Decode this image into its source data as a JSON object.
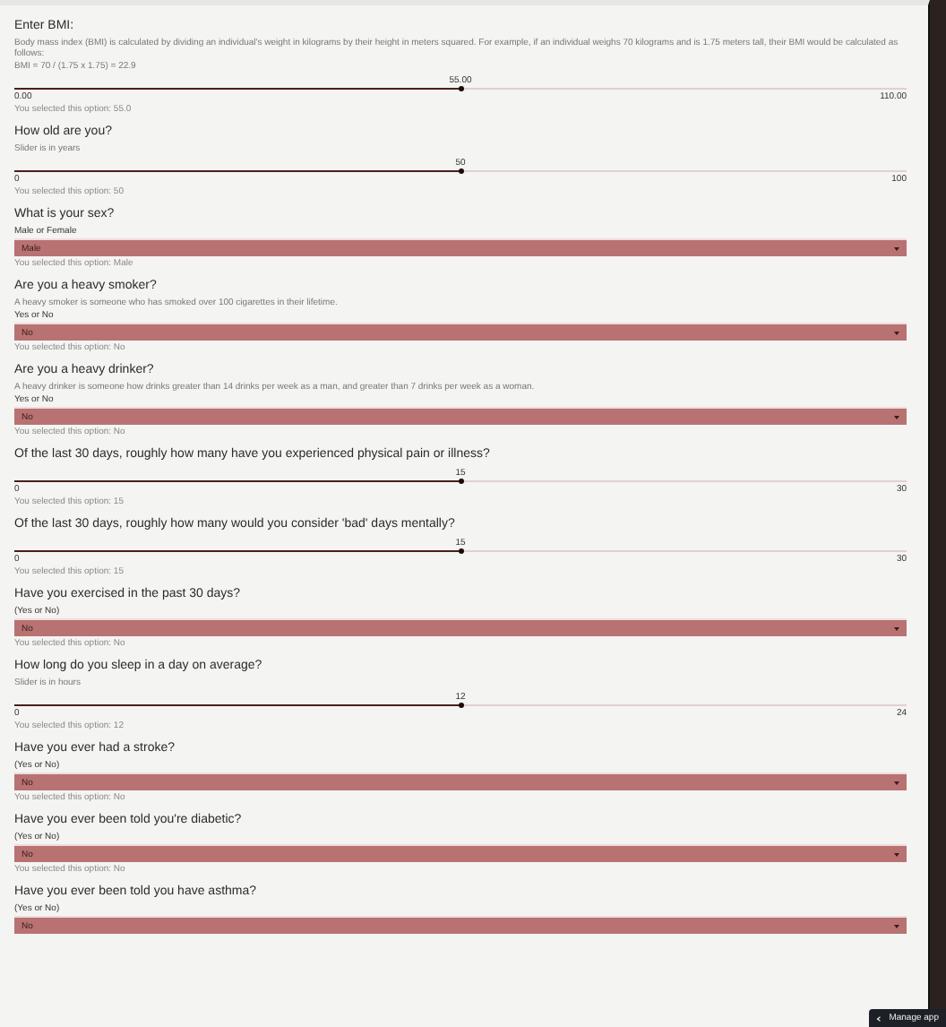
{
  "questions": [
    {
      "kind": "slider",
      "question": "Enter BMI:",
      "help": "Body mass index (BMI) is calculated by dividing an individual's weight in kilograms by their height in meters squared. For example, if an individual weighs 70 kilograms and is 1.75 meters tall, their BMI would be calculated as follows:",
      "formula": "BMI = 70 / (1.75 x 1.75) = 22.9",
      "value_label": "55.00",
      "min_label": "0.00",
      "max_label": "110.00",
      "level": 0.5,
      "selected_text": "You selected this option: 55.0"
    },
    {
      "kind": "slider",
      "question": "How old are you?",
      "help": "Slider is in years",
      "value_label": "50",
      "min_label": "0",
      "max_label": "100",
      "level": 0.5,
      "selected_text": "You selected this option: 50"
    },
    {
      "kind": "select",
      "question": "What is your sex?",
      "field_label": "Male or Female",
      "value": "Male",
      "selected_text": "You selected this option: Male"
    },
    {
      "kind": "select",
      "question": "Are you a heavy smoker?",
      "help": "A heavy smoker is someone who has smoked over 100 cigarettes in their lifetime.",
      "field_label": "Yes or No",
      "value": "No",
      "selected_text": "You selected this option: No"
    },
    {
      "kind": "select",
      "question": "Are you a heavy drinker?",
      "help": "A heavy drinker is someone how drinks greater than 14 drinks per week as a man, and greater than 7 drinks per week as a woman.",
      "field_label": "Yes or No",
      "value": "No",
      "selected_text": "You selected this option: No"
    },
    {
      "kind": "slider",
      "question": "Of the last 30 days, roughly how many have you experienced physical pain or illness?",
      "value_label": "15",
      "min_label": "0",
      "max_label": "30",
      "level": 0.5,
      "selected_text": "You selected this option: 15"
    },
    {
      "kind": "slider",
      "question": "Of the last 30 days, roughly how many would you consider 'bad' days mentally?",
      "value_label": "15",
      "min_label": "0",
      "max_label": "30",
      "level": 0.5,
      "selected_text": "You selected this option: 15"
    },
    {
      "kind": "select",
      "question": "Have you exercised in the past 30 days?",
      "field_label": "(Yes or No)",
      "value": "No",
      "selected_text": "You selected this option: No"
    },
    {
      "kind": "slider",
      "question": "How long do you sleep in a day on average?",
      "help": "Slider is in hours",
      "value_label": "12",
      "min_label": "0",
      "max_label": "24",
      "level": 0.5,
      "selected_text": "You selected this option: 12"
    },
    {
      "kind": "select",
      "question": "Have you ever had a stroke?",
      "field_label": "(Yes or No)",
      "value": "No",
      "selected_text": "You selected this option: No"
    },
    {
      "kind": "select",
      "question": "Have you ever been told you're diabetic?",
      "field_label": "(Yes or No)",
      "value": "No",
      "selected_text": "You selected this option: No"
    },
    {
      "kind": "select",
      "question": "Have you ever been told you have asthma?",
      "field_label": "(Yes or No)",
      "value": "No"
    }
  ],
  "manage_button": {
    "label": "Manage app"
  }
}
